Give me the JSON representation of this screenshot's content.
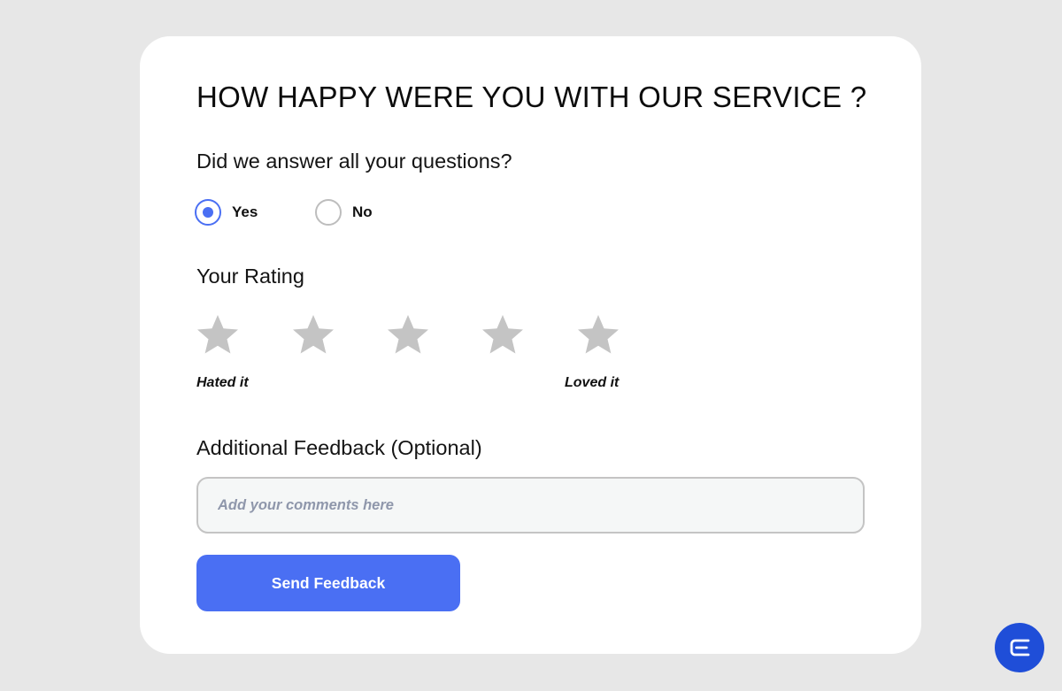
{
  "survey": {
    "title": "HOW HAPPY WERE YOU WITH OUR SERVICE ?",
    "question": "Did we answer all your questions?",
    "answer_options": [
      {
        "label": "Yes",
        "selected": true
      },
      {
        "label": "No",
        "selected": false
      }
    ],
    "rating": {
      "title": "Your Rating",
      "max_stars": 5,
      "selected_stars": 0,
      "low_label": "Hated it",
      "high_label": "Loved it"
    },
    "feedback": {
      "title": "Additional Feedback (Optional)",
      "value": "",
      "placeholder": "Add your comments here"
    },
    "submit_label": "Send Feedback"
  },
  "icons": {
    "star": "star-icon",
    "assistant": "chat-assistant-icon"
  },
  "colors": {
    "background": "#e7e7e7",
    "card": "#ffffff",
    "accent": "#4a6ff3",
    "star_inactive": "#c4c4c4",
    "fab": "#1f4ed8"
  }
}
